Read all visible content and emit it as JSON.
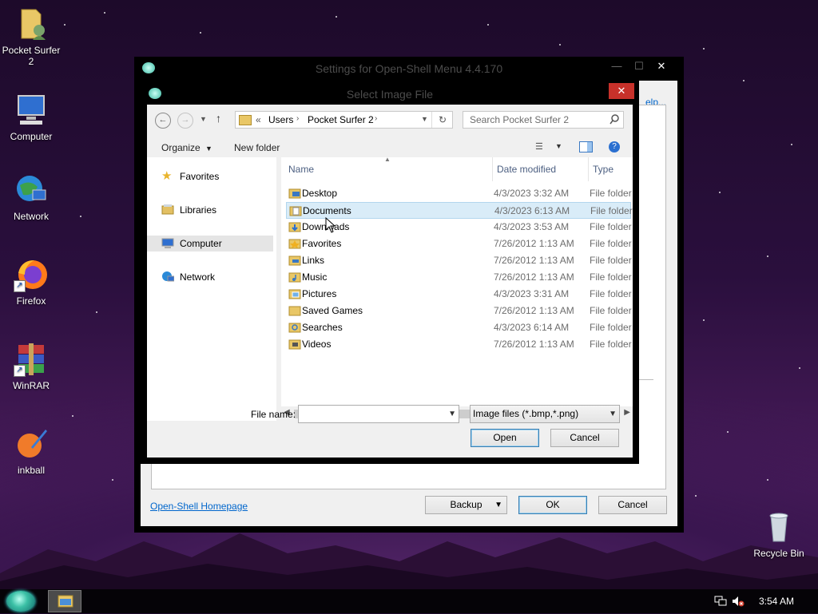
{
  "desktop": {
    "icons": [
      {
        "name": "pocket-surfer",
        "label": "Pocket Surfer 2"
      },
      {
        "name": "computer",
        "label": "Computer"
      },
      {
        "name": "network",
        "label": "Network"
      },
      {
        "name": "firefox",
        "label": "Firefox"
      },
      {
        "name": "winrar",
        "label": "WinRAR"
      },
      {
        "name": "inkball",
        "label": "inkball"
      },
      {
        "name": "recycle-bin",
        "label": "Recycle Bin"
      }
    ]
  },
  "taskbar": {
    "clock": "3:54 AM",
    "icons": [
      "start-orb-icon",
      "file-explorer-icon",
      "network-tray-icon",
      "volume-muted-icon"
    ]
  },
  "settings_window": {
    "title": "Settings for Open-Shell Menu 4.4.170",
    "help_link": "elp...",
    "homepage_link": "Open-Shell Homepage",
    "backup_button": "Backup",
    "ok_button": "OK",
    "cancel_button": "Cancel"
  },
  "dialog": {
    "title": "Select Image File",
    "close_glyph": "✕",
    "address": {
      "overflow": "«",
      "crumbs": [
        "Users",
        "Pocket Surfer 2"
      ]
    },
    "search_placeholder": "Search Pocket Surfer 2",
    "toolbar": {
      "organize": "Organize",
      "new_folder": "New folder"
    },
    "nav": {
      "favorites": "Favorites",
      "libraries": "Libraries",
      "computer": "Computer",
      "network": "Network"
    },
    "columns": {
      "name": "Name",
      "date": "Date modified",
      "type": "Type"
    },
    "files": [
      {
        "name": "Desktop",
        "date": "4/3/2023 3:32 AM",
        "type": "File folder",
        "icon": "desktop-folder-icon"
      },
      {
        "name": "Documents",
        "date": "4/3/2023 6:13 AM",
        "type": "File folder",
        "icon": "documents-folder-icon",
        "selected": true
      },
      {
        "name": "Downloads",
        "date": "4/3/2023 3:53 AM",
        "type": "File folder",
        "icon": "downloads-folder-icon"
      },
      {
        "name": "Favorites",
        "date": "7/26/2012 1:13 AM",
        "type": "File folder",
        "icon": "favorites-folder-icon"
      },
      {
        "name": "Links",
        "date": "7/26/2012 1:13 AM",
        "type": "File folder",
        "icon": "links-folder-icon"
      },
      {
        "name": "Music",
        "date": "7/26/2012 1:13 AM",
        "type": "File folder",
        "icon": "music-folder-icon"
      },
      {
        "name": "Pictures",
        "date": "4/3/2023 3:31 AM",
        "type": "File folder",
        "icon": "pictures-folder-icon"
      },
      {
        "name": "Saved Games",
        "date": "7/26/2012 1:13 AM",
        "type": "File folder",
        "icon": "saved-games-folder-icon"
      },
      {
        "name": "Searches",
        "date": "4/3/2023 6:14 AM",
        "type": "File folder",
        "icon": "searches-folder-icon"
      },
      {
        "name": "Videos",
        "date": "7/26/2012 1:13 AM",
        "type": "File folder",
        "icon": "videos-folder-icon"
      }
    ],
    "file_name_label": "File name:",
    "file_name_value": "",
    "file_type": "Image files (*.bmp,*.png)",
    "open_button": "Open",
    "cancel_button": "Cancel"
  },
  "colors": {
    "accent_close": "#c7312a",
    "selection": "#d9ecf8",
    "link": "#0066cc"
  }
}
